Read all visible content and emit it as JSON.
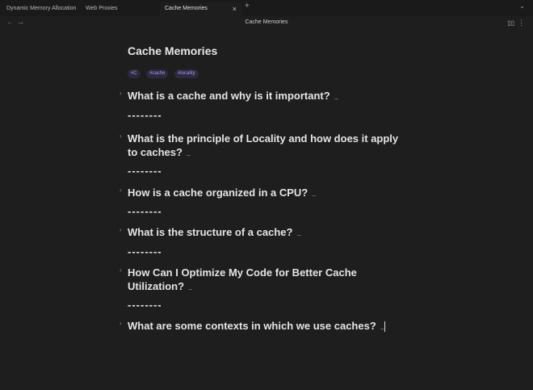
{
  "tabs": [
    {
      "label": "Dynamic Memory Allocation"
    },
    {
      "label": "Web Proxies"
    },
    {
      "label": "Cache Memories"
    }
  ],
  "tab_icons": {
    "close": "×",
    "new": "+",
    "menu": "⌄"
  },
  "nav": {
    "back": "←",
    "forward": "→",
    "title": "Cache Memories",
    "reading_icon": "▯▯",
    "more_icon": "⋮"
  },
  "note": {
    "title": "Cache Memories",
    "tags": [
      "#C",
      "#cache",
      "#locality"
    ],
    "separator": "--------",
    "fold_glyph": "›",
    "ellipsis": "...",
    "headings": [
      {
        "line1": "What is a cache and why is it important?",
        "line2": ""
      },
      {
        "line1": "What is the principle of Locality and how does it apply",
        "line2": "to caches?"
      },
      {
        "line1": "How is a cache organized in a CPU?",
        "line2": ""
      },
      {
        "line1": "What is the structure of a cache?",
        "line2": ""
      },
      {
        "line1": "How Can I Optimize My Code for Better Cache",
        "line2": "Utilization?"
      },
      {
        "line1": "What are some contexts in which we use caches?",
        "line2": ""
      }
    ]
  }
}
